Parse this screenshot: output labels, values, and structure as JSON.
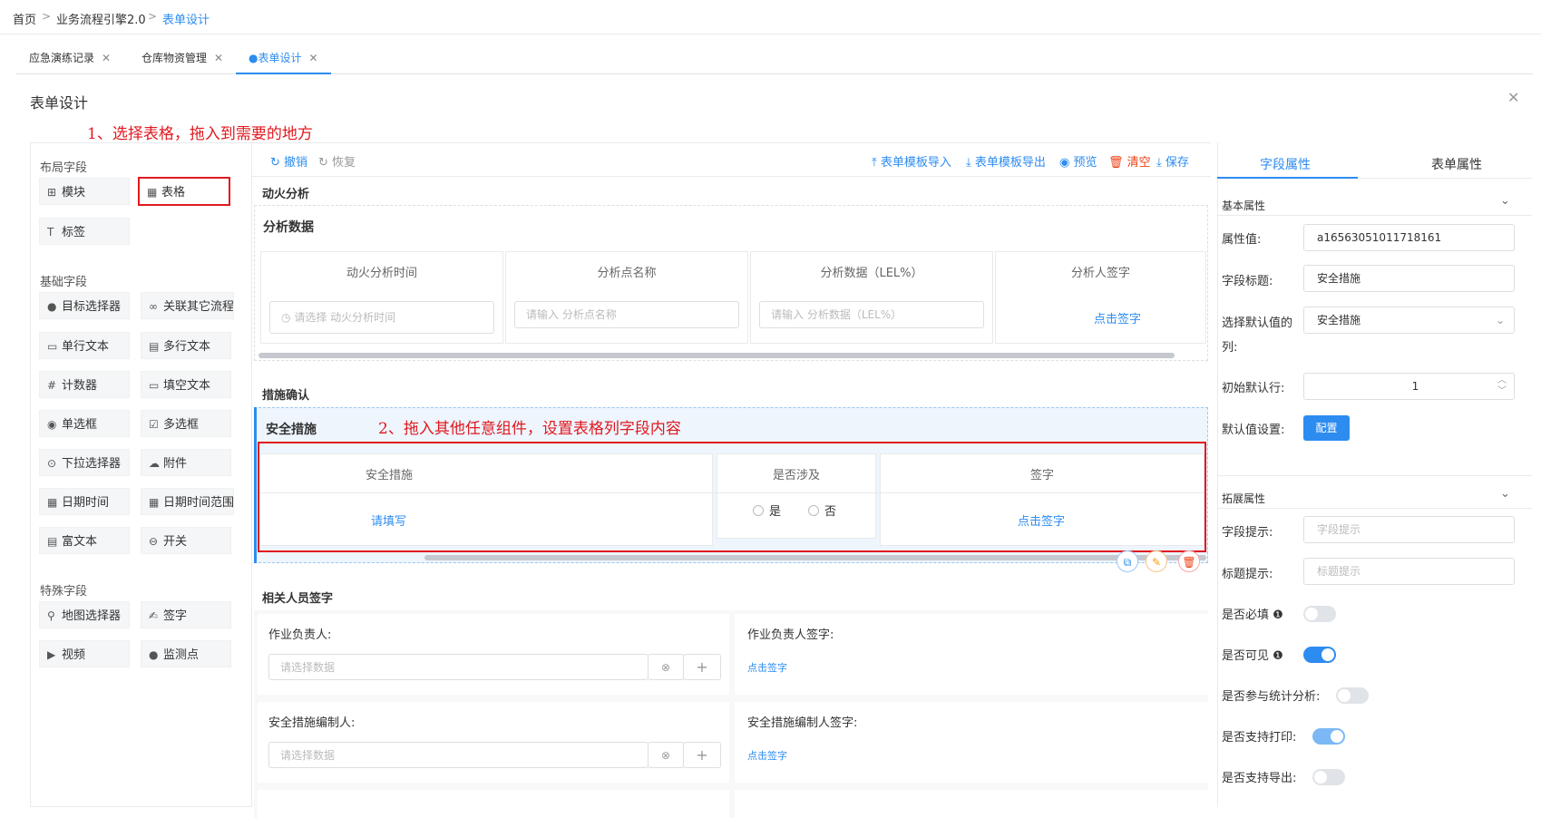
{
  "breadcrumb": {
    "home": "首页",
    "engine": "业务流程引擎2.0",
    "current": "表单设计"
  },
  "tabs": [
    {
      "label": "应急演练记录"
    },
    {
      "label": "仓库物资管理"
    },
    {
      "label": "●表单设计"
    }
  ],
  "page_title": "表单设计",
  "annotation1": "1、选择表格，拖入到需要的地方",
  "annotation2": "2、拖入其他任意组件，设置表格列字段内容",
  "left": {
    "layout_title": "布局字段",
    "layout": [
      "模块",
      "表格",
      "标签"
    ],
    "basic_title": "基础字段",
    "basic": [
      "目标选择器",
      "关联其它流程",
      "单行文本",
      "多行文本",
      "计数器",
      "填空文本",
      "单选框",
      "多选框",
      "下拉选择器",
      "附件",
      "日期时间",
      "日期时间范围",
      "富文本",
      "开关"
    ],
    "special_title": "特殊字段",
    "special": [
      "地图选择器",
      "签字",
      "视频",
      "监测点"
    ]
  },
  "toolbar": {
    "undo": "撤销",
    "redo": "恢复",
    "import": "表单模板导入",
    "export": "表单模板导出",
    "preview": "预览",
    "clear": "清空",
    "save": "保存"
  },
  "canvas": {
    "section1": "动火分析",
    "table1_title": "分析数据",
    "table1_cols": [
      "动火分析时间",
      "分析点名称",
      "分析数据（LEL%）",
      "分析人签字"
    ],
    "table1_placeholders": [
      "请选择 动火分析时间",
      "请输入 分析点名称",
      "请输入 分析数据（LEL%）"
    ],
    "sign_link": "点击签字",
    "section2": "措施确认",
    "table2_title": "安全措施",
    "table2_cols": [
      "安全措施",
      "是否涉及",
      "签字"
    ],
    "table2_fill": "请填写",
    "yes": "是",
    "no": "否",
    "section3": "相关人员签字",
    "person1": "作业负责人:",
    "person1_sign": "作业负责人签字:",
    "person2": "安全措施编制人:",
    "person2_sign": "安全措施编制人签字:",
    "select_ph": "请选择数据",
    "small_sign": "点击签字"
  },
  "right": {
    "tab_field": "字段属性",
    "tab_form": "表单属性",
    "basic": "基本属性",
    "attr_value_label": "属性值:",
    "attr_value": "a16563051011718161",
    "title_label": "字段标题:",
    "title_value": "安全措施",
    "default_col_label1": "选择默认值的",
    "default_col_label2": "列:",
    "default_col_value": "安全措施",
    "init_rows_label": "初始默认行:",
    "init_rows_value": "1",
    "default_setting_label": "默认值设置:",
    "config_btn": "配置",
    "ext": "拓展属性",
    "hint_label": "字段提示:",
    "hint_ph": "字段提示",
    "title_hint_label": "标题提示:",
    "title_hint_ph": "标题提示",
    "required": "是否必填",
    "visible": "是否可见",
    "stats": "是否参与统计分析:",
    "print": "是否支持打印:",
    "export": "是否支持导出:"
  }
}
